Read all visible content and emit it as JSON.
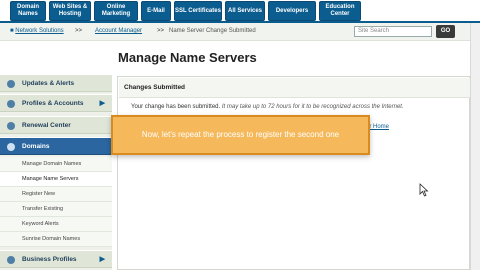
{
  "nav": {
    "tabs": [
      {
        "label": "Domain Names"
      },
      {
        "label": "Web Sites & Hosting"
      },
      {
        "label": "Online Marketing"
      },
      {
        "label": "E-Mail"
      },
      {
        "label": "SSL Certificates"
      },
      {
        "label": "All Services"
      },
      {
        "label": "Developers"
      },
      {
        "label": "Education Center"
      }
    ]
  },
  "breadcrumb": {
    "home": "Network Solutions",
    "sep1": ">>",
    "account": "Account Manager",
    "sep2": ">>",
    "current": "Name Server Change Submitted"
  },
  "search": {
    "placeholder": "Site Search",
    "go_label": "GO"
  },
  "page": {
    "title": "Manage Name Servers"
  },
  "sidebar": {
    "sections": [
      {
        "label": "Updates & Alerts"
      },
      {
        "label": "Profiles & Accounts"
      },
      {
        "label": "Renewal Center"
      },
      {
        "label": "Domains"
      }
    ],
    "sub_items": [
      {
        "label": "Manage Domain Names"
      },
      {
        "label": "Manage Name Servers"
      },
      {
        "label": "Register New"
      },
      {
        "label": "Transfer Existing"
      },
      {
        "label": "Keyword Alerts"
      },
      {
        "label": "Sunrise Domain Names"
      }
    ],
    "bottom_section": {
      "label": "Business Profiles"
    }
  },
  "panel": {
    "heading": "Changes Submitted",
    "message": "Your change has been submitted.",
    "message_note": "It may take up to 72 hours for it to be recognized across the Internet.",
    "link_fragment": "er Home"
  },
  "tooltip": {
    "text": "Now, let's repeat the process to register the second one"
  },
  "colors": {
    "nav_blue": "#0b5c8f",
    "tooltip_bg": "#f5b95c",
    "sidebar_active": "#2b66a0"
  }
}
